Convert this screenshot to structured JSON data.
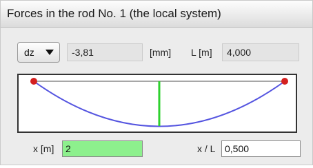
{
  "window": {
    "title": "Forces in the rod No. 1 (the local system)"
  },
  "toolbar": {
    "component_select": "dz",
    "value": "-3,81",
    "unit": "[mm]",
    "length_label": "L [m]",
    "length_value": "4,000"
  },
  "plot": {
    "curve_color": "#5555e0",
    "marker_color": "#2ed12e",
    "end_point_color": "#d42020"
  },
  "position": {
    "x_label": "x [m]",
    "x_value": "2",
    "xl_label": "x / L",
    "xl_value": "0,500"
  },
  "colors": {
    "x_field_bg": "#8df08d",
    "panel_bg": "#ececec"
  }
}
